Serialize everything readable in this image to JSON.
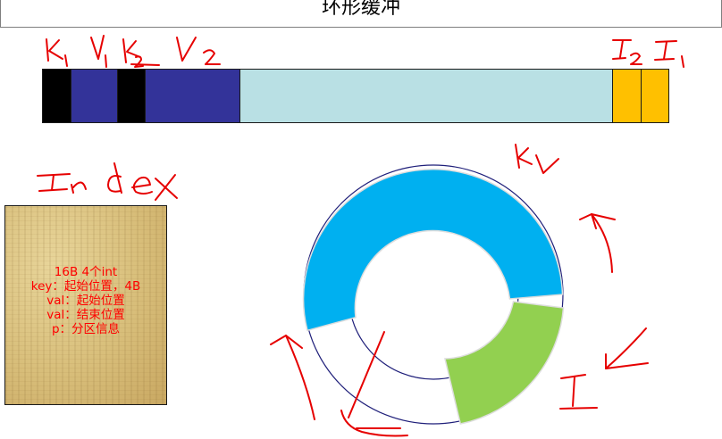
{
  "title": "环形缓冲",
  "buffer": {
    "segments": [
      {
        "id": "k1",
        "color": "#000000"
      },
      {
        "id": "v1",
        "color": "#333399"
      },
      {
        "id": "k2",
        "color": "#000000"
      },
      {
        "id": "v2",
        "color": "#333399"
      },
      {
        "id": "free",
        "color": "#b9e0e4"
      },
      {
        "id": "i2",
        "color": "#ffc000"
      },
      {
        "id": "i1",
        "color": "#ffc000"
      }
    ]
  },
  "handwritten_labels": [
    "k1",
    "V1",
    "k2",
    "V2",
    "I2",
    "I1",
    "Index",
    "KV",
    "I"
  ],
  "index_card": {
    "lines": [
      "16B  4个int",
      "key：起始位置，4B",
      "val：起始位置",
      "val：结束位置",
      "p：分区信息"
    ]
  },
  "ring": {
    "colors": {
      "kv": "#00b0f0",
      "index": "#92d050",
      "empty": "#ffffff",
      "outline": "#1f1f7a"
    }
  },
  "colors": {
    "ink": "#e60000"
  }
}
